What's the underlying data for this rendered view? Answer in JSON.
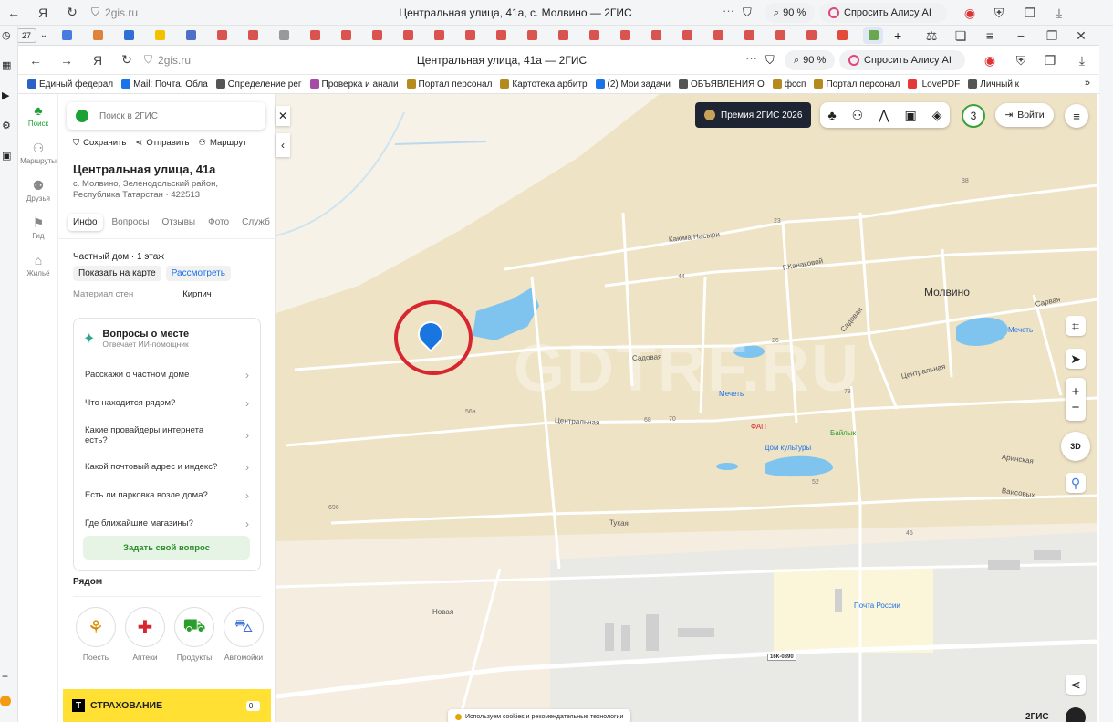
{
  "browser": {
    "outer_url": "2gis.ru",
    "outer_title": "Центральная улица, 41а, с. Молвино — 2ГИС",
    "outer_zoom": "90 %",
    "alice": "Спросить Алису AI",
    "tab_count": "27",
    "inner_url": "2gis.ru",
    "inner_title": "Центральная улица, 41а — 2ГИС",
    "inner_zoom": "90 %",
    "inner_alice": "Спросить Алису AI",
    "tab_colors": [
      "#4a7be0",
      "#e0823a",
      "#2f6fd6",
      "#f2c200",
      "#4d6fc9",
      "#d9534f",
      "#d9534f",
      "#999",
      "#d9534f",
      "#d9534f",
      "#d9534f",
      "#d9534f",
      "#d9534f",
      "#d9534f",
      "#d9534f",
      "#d9534f",
      "#d9534f",
      "#d9534f",
      "#d9534f",
      "#d9534f",
      "#d9534f",
      "#d9534f",
      "#d9534f",
      "#d9534f",
      "#d9534f",
      "#e34b3a",
      "#6aa84f"
    ]
  },
  "bookmarks": [
    {
      "label": "Единый федерал",
      "color": "#2b62c7"
    },
    {
      "label": "Mail: Почта, Обла",
      "color": "#1a73e8"
    },
    {
      "label": "Определение рег",
      "color": "#555"
    },
    {
      "label": "Проверка и анали",
      "color": "#a64ca6"
    },
    {
      "label": "Портал персонал",
      "color": "#b58b1e"
    },
    {
      "label": "Картотека арбитр",
      "color": "#b58b1e"
    },
    {
      "label": "(2) Мои задачи",
      "color": "#1a73e8"
    },
    {
      "label": "ОБЪЯВЛЕНИЯ О",
      "color": "#555"
    },
    {
      "label": "фссп",
      "color": "#b58b1e"
    },
    {
      "label": "Портал персонал",
      "color": "#b58b1e"
    },
    {
      "label": "iLovePDF",
      "color": "#e53935"
    },
    {
      "label": "Личный к",
      "color": "#555"
    }
  ],
  "app_nav": [
    {
      "label": "Поиск",
      "icon": "tree-icon",
      "active": true
    },
    {
      "label": "Маршруты",
      "icon": "route-icon",
      "active": false
    },
    {
      "label": "Друзья",
      "icon": "friends-icon",
      "active": false
    },
    {
      "label": "Гид",
      "icon": "flag-icon",
      "active": false
    },
    {
      "label": "Жильё",
      "icon": "home-icon",
      "active": false
    }
  ],
  "search": {
    "placeholder": "Поиск в 2ГИС"
  },
  "actions": {
    "save": "Сохранить",
    "send": "Отправить",
    "route": "Маршрут"
  },
  "place": {
    "title": "Центральная улица, 41а",
    "address_line1": "с. Молвино, Зеленодольский район,",
    "address_line2": "Республика Татарстан · 422513"
  },
  "tabs": [
    "Инфо",
    "Вопросы",
    "Отзывы",
    "Фото",
    "Служб"
  ],
  "info": {
    "type": "Частный дом · 1 этаж",
    "show_on_map": "Показать на карте",
    "expand": "Рассмотреть",
    "material_label": "Материал стен",
    "material_value": "Кирпич"
  },
  "questions": {
    "title": "Вопросы о месте",
    "subtitle": "Отвечает ИИ-помощник",
    "items": [
      "Расскажи о частном доме",
      "Что находится рядом?",
      "Какие провайдеры интернета есть?",
      "Какой почтовый адрес и индекс?",
      "Есть ли парковка возле дома?",
      "Где ближайшие магазины?"
    ],
    "ask": "Задать свой вопрос"
  },
  "nearby": {
    "title": "Рядом",
    "items": [
      "Поесть",
      "Аптеки",
      "Продукты",
      "Автомойки"
    ]
  },
  "banner": {
    "text": "СТРАХОВАНИЕ",
    "age": "0+"
  },
  "map": {
    "premium": "Премия 2ГИС 2026",
    "notif": "3",
    "login": "Войти",
    "mode_3d": "3D",
    "brand": "2ГИС",
    "cookies": "Используем cookies и рекомендательные технологии",
    "watermark": "GDTRF.RU",
    "labels": {
      "village": "Молвино",
      "kaoma": "Каюма Насыри",
      "kanak": "Г.Канаковой",
      "sadovaya": "Садовая",
      "sadovaya2": "Садовая",
      "sarvaya": "Сарвая",
      "central": "Центральная",
      "central2": "Центральная",
      "mosque": "Мечеть",
      "mosque2": "Мечеть",
      "fap": "ФАП",
      "culture": "Дом культуры",
      "baylyk": "Байлык",
      "arinskaya": "Аринская",
      "vaisovy": "Ваисовых",
      "tukay": "Тукая",
      "novaya": "Новая",
      "post": "Почта России",
      "road": "16К-0890",
      "n23": "23",
      "n44": "44",
      "n26": "26",
      "n78": "78",
      "n68": "68",
      "n70": "70",
      "n56a": "56а",
      "n52": "52",
      "n45": "45",
      "n696": "696",
      "n38": "38"
    }
  }
}
